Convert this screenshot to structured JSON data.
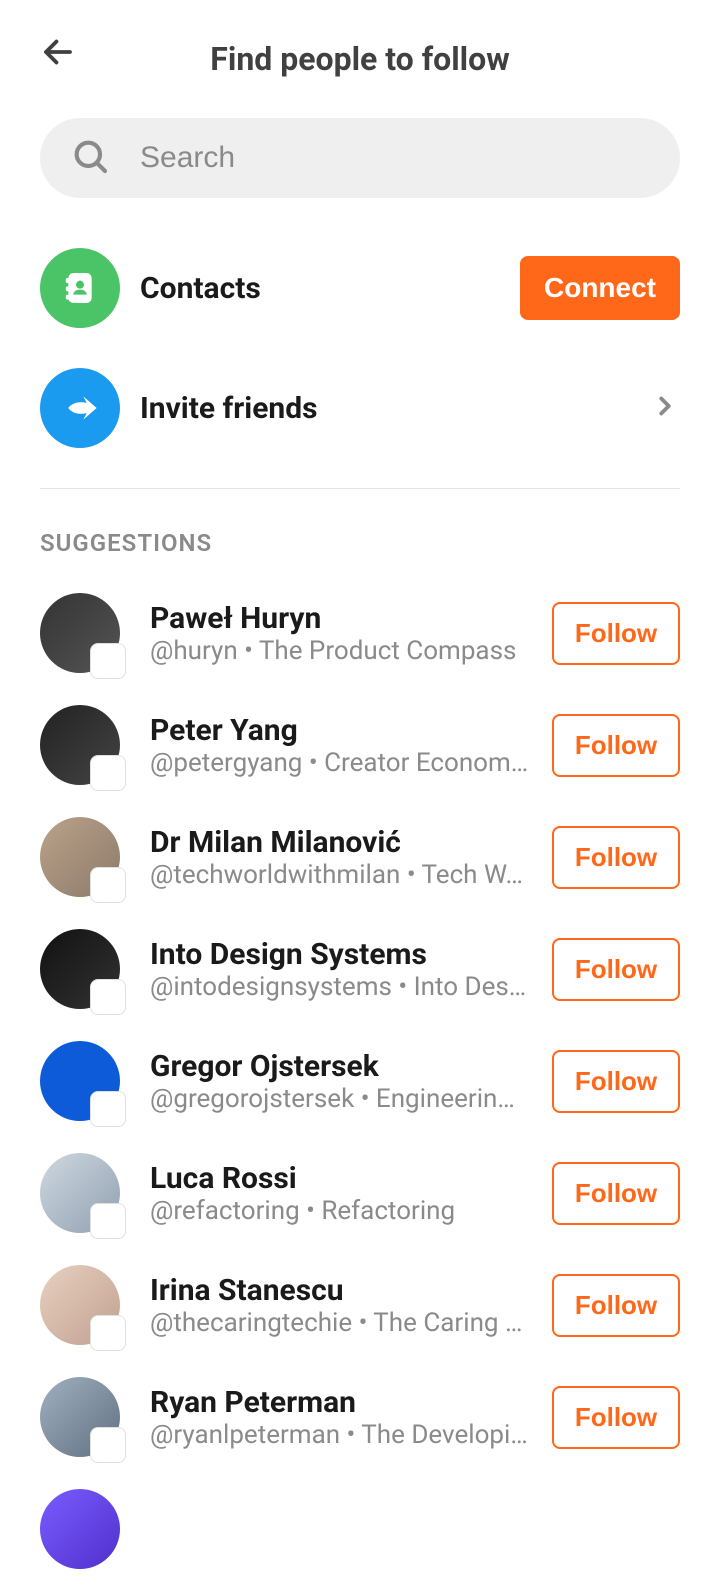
{
  "header": {
    "title": "Find people to follow"
  },
  "search": {
    "placeholder": "Search"
  },
  "actions": {
    "contacts": {
      "label": "Contacts",
      "button": "Connect"
    },
    "invite": {
      "label": "Invite friends"
    }
  },
  "section": {
    "suggestions_label": "SUGGESTIONS"
  },
  "follow_label": "Follow",
  "suggestions": [
    {
      "name": "Paweł Huryn",
      "sub": "@huryn • The Product Compass"
    },
    {
      "name": "Peter Yang",
      "sub": "@petergyang • Creator Econom…"
    },
    {
      "name": "Dr Milan Milanović",
      "sub": "@techworldwithmilan • Tech W…"
    },
    {
      "name": "Into Design Systems",
      "sub": "@intodesignsystems • Into Des…"
    },
    {
      "name": "Gregor Ojstersek",
      "sub": "@gregorojstersek • Engineerin…"
    },
    {
      "name": "Luca Rossi",
      "sub": "@refactoring • Refactoring"
    },
    {
      "name": "Irina Stanescu",
      "sub": "@thecaringtechie • The Caring …"
    },
    {
      "name": "Ryan Peterman",
      "sub": "@ryanlpeterman • The Developi…"
    }
  ],
  "colors": {
    "accent": "#ff6719"
  }
}
